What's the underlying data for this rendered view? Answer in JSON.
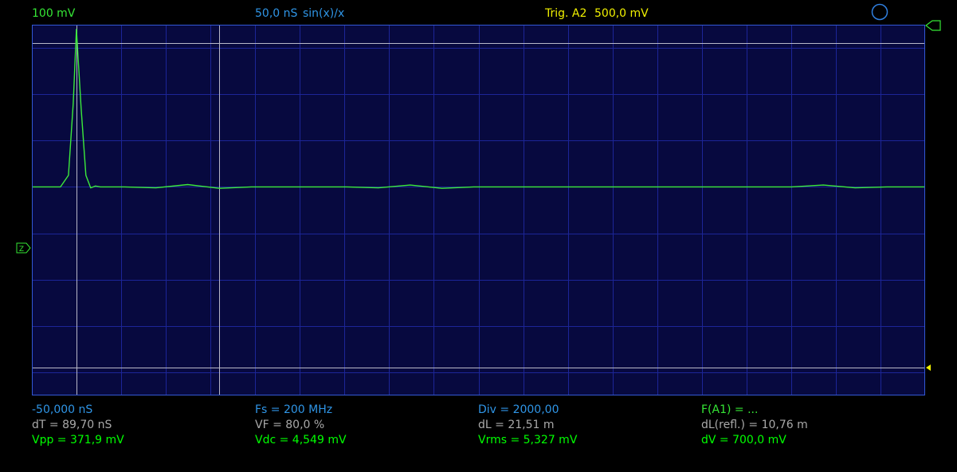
{
  "header": {
    "volts_per_div": "100 mV",
    "time_per_div": "50,0 nS",
    "interpolation": "sin(x)/x",
    "trigger_channel": "Trig. A2",
    "trigger_level": "500,0 mV"
  },
  "markers": {
    "zero_marker": "Z"
  },
  "readouts": {
    "row1": {
      "cursor_time": "-50,000 nS",
      "sample_rate": "Fs = 200 MHz",
      "divider": "Div = 2000,00",
      "function": "F(A1) = ..."
    },
    "row2": {
      "delta_t": "dT = 89,70 nS",
      "velocity_factor": "VF = 80,0 %",
      "delta_length": "dL = 21,51 m",
      "delta_length_reflected": "dL(refl.) = 10,76 m"
    },
    "row3": {
      "vpp": "Vpp = 371,9 mV",
      "vdc": "Vdc = 4,549 mV",
      "vrms": "Vrms = 5,327 mV",
      "delta_v": "dV = 700,0 mV"
    }
  },
  "colors": {
    "grid_background": "#07093f",
    "grid_border": "#3358d6",
    "grid_lines": "#1c2597",
    "trace": "#3cea3c",
    "cursor": "#b8b8c8",
    "trigger_marker": "#f0f000"
  },
  "chart_data": {
    "type": "line",
    "x_unit": "nS",
    "y_unit": "mV",
    "xlim": [
      -78,
      484
    ],
    "ylim": [
      -450,
      350
    ],
    "grid": true,
    "grid_x_step": 28.1,
    "grid_y_step": 100,
    "cursors_x": [
      -50,
      39.7
    ],
    "cursors_y": [
      310,
      -390
    ],
    "trigger_level_mV": -390,
    "x": [
      -78,
      -60,
      -55,
      -52,
      -50,
      -47,
      -44,
      -41,
      -38,
      -35,
      -30,
      -20,
      0,
      20,
      40,
      60,
      80,
      100,
      120,
      140,
      160,
      180,
      200,
      220,
      240,
      260,
      280,
      300,
      320,
      340,
      360,
      380,
      400,
      420,
      440,
      460,
      484
    ],
    "y": [
      0,
      0,
      25,
      180,
      340,
      170,
      25,
      -2,
      2,
      0,
      0,
      0,
      -2,
      5,
      -3,
      0,
      0,
      0,
      0,
      -2,
      4,
      -3,
      0,
      0,
      0,
      0,
      0,
      0,
      0,
      0,
      0,
      0,
      0,
      4,
      -2,
      0,
      0
    ]
  }
}
